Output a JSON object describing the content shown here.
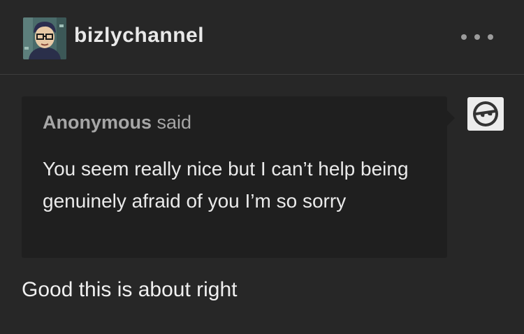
{
  "post": {
    "username": "bizlychannel",
    "more_icon": "ellipsis-icon",
    "ask": {
      "asker": "Anonymous",
      "said": "said",
      "question": "You seem really nice but I can’t help being genuinely afraid of you I’m so sorry",
      "asker_avatar_icon": "anonymous-sunglasses-icon"
    },
    "answer": "Good this is about right"
  }
}
